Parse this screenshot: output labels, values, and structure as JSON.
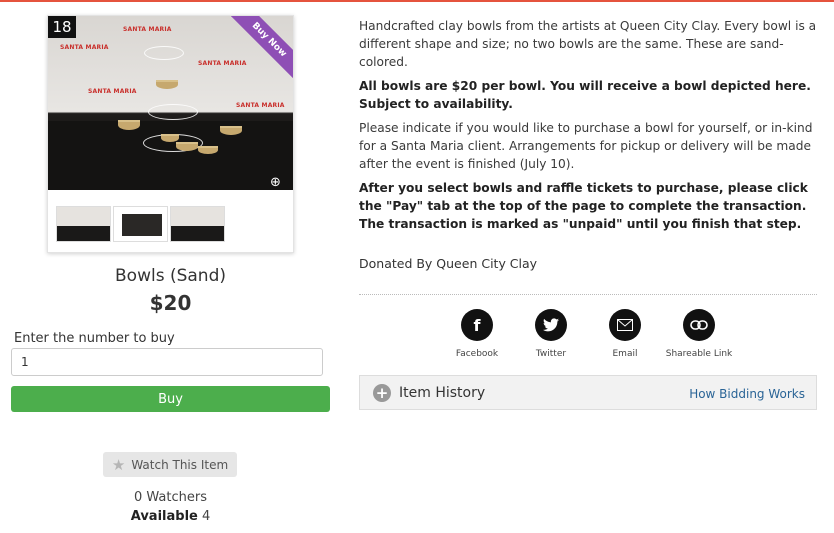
{
  "item": {
    "number": "18",
    "ribbon": "Buy Now",
    "title": "Bowls (Sand)",
    "price": "$20"
  },
  "purchase": {
    "qty_label": "Enter the number to buy",
    "qty_value": "1",
    "buy_label": "Buy"
  },
  "watch": {
    "button_label": "Watch This Item",
    "watchers": "0 Watchers",
    "available_label": "Available",
    "available_count": "4"
  },
  "description": {
    "p1": "Handcrafted clay bowls from the artists at Queen City Clay. Every bowl is a different shape and size; no two bowls are the same. These are sand-colored.",
    "p2": "All bowls are $20 per bowl. You will receive a bowl depicted here. Subject to availability.",
    "p3": "Please indicate if you would like to purchase a bowl for yourself, or in-kind for a Santa Maria client. Arrangements for pickup or delivery will be made after the event is finished (July 10).",
    "p4": "After you select bowls and raffle tickets to purchase, please click the \"Pay\" tab at the top of the page to complete the transaction. The transaction is marked as \"unpaid\" until you finish that step.",
    "donated": "Donated By Queen City Clay"
  },
  "share": {
    "facebook": "Facebook",
    "twitter": "Twitter",
    "email": "Email",
    "link": "Shareable Link"
  },
  "history": {
    "title": "Item History",
    "link": "How Bidding Works"
  },
  "backdrop": {
    "logo": "SANTA MARIA"
  },
  "colors": {
    "buy_button": "#4cae4c",
    "ribbon": "#8e4fb5",
    "link": "#2a6496",
    "top_accent": "#e5533d"
  }
}
